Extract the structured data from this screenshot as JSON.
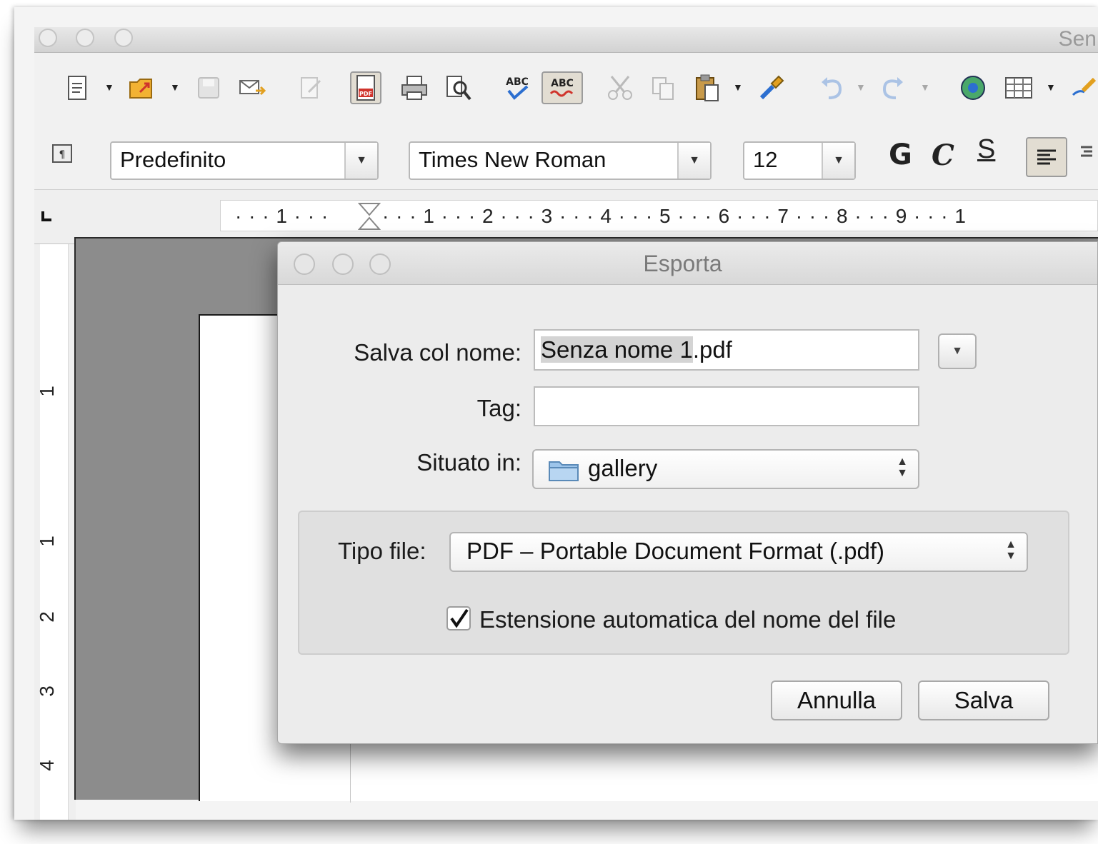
{
  "app": {
    "title_fragment": "Sen"
  },
  "toolbar_standard": {
    "icons": [
      "new-document-icon",
      "open-icon",
      "save-icon",
      "email-icon",
      "edit-file-icon",
      "export-pdf-icon",
      "print-icon",
      "print-preview-icon",
      "spellcheck-icon",
      "autospellcheck-icon",
      "cut-icon",
      "copy-icon",
      "paste-icon",
      "clone-formatting-icon",
      "undo-icon",
      "redo-icon",
      "navigator-icon",
      "table-icon",
      "draw-icon"
    ]
  },
  "toolbar_formatting": {
    "paragraph_style": "Predefinito",
    "font_name": "Times New Roman",
    "font_size": "12",
    "bold_label": "G",
    "italic_label": "C",
    "underline_label": "S"
  },
  "ruler": {
    "labels": [
      "1",
      "1",
      "2",
      "3",
      "4",
      "5",
      "6",
      "7",
      "8",
      "9",
      "1"
    ],
    "vertical_labels": [
      "1",
      "1",
      "2",
      "3",
      "4"
    ]
  },
  "dialog": {
    "title": "Esporta",
    "save_as_label": "Salva col nome:",
    "filename_selected": "Senza nome 1",
    "filename_rest": ".pdf",
    "tags_label": "Tag:",
    "tags_value": "",
    "where_label": "Situato in:",
    "where_value": "gallery",
    "file_type_label": "Tipo file:",
    "file_type_value": "PDF – Portable Document Format (.pdf)",
    "auto_extension_label": "Estensione automatica del nome del file",
    "auto_extension_checked": true,
    "cancel_label": "Annulla",
    "save_label": "Salva"
  }
}
